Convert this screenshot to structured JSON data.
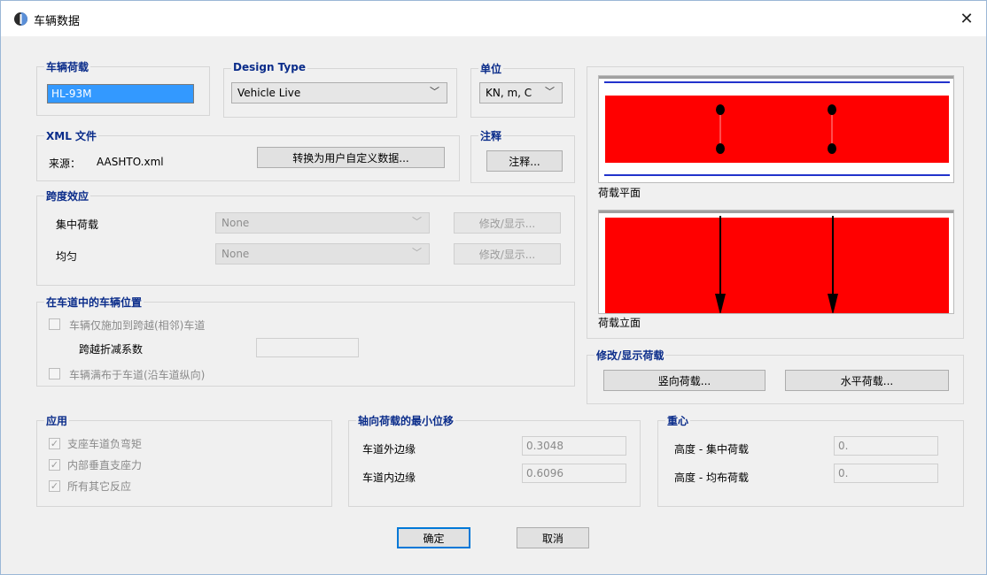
{
  "window": {
    "title": "车辆数据",
    "close_glyph": "✕"
  },
  "vehicle_load": {
    "legend": "车辆荷载",
    "name_value": "HL-93M"
  },
  "design_type": {
    "legend": "Design Type",
    "value": "Vehicle Live"
  },
  "units": {
    "legend": "单位",
    "value": "KN, m, C"
  },
  "xml_file": {
    "legend": "XML 文件",
    "source_label": "来源：",
    "source_value": "AASHTO.xml",
    "convert_button": "转换为用户自定义数据..."
  },
  "notes": {
    "legend": "注释",
    "button": "注释..."
  },
  "span_effect": {
    "legend": "跨度效应",
    "concentrated_label": "集中荷载",
    "concentrated_value": "None",
    "uniform_label": "均匀",
    "uniform_value": "None",
    "modify_button": "修改/显示..."
  },
  "lane_position": {
    "legend": "在车道中的车辆位置",
    "straddle_label": "车辆仅施加到跨越(相邻)车道",
    "straddle_factor_label": "跨越折减系数",
    "straddle_factor_value": "",
    "fill_lane_label": "车辆满布于车道(沿车道纵向)"
  },
  "application": {
    "legend": "应用",
    "items": [
      "支座车道负弯矩",
      "内部垂直支座力",
      "所有其它反应"
    ]
  },
  "axle_min_offset": {
    "legend": "轴向荷载的最小位移",
    "outer_label": "车道外边缘",
    "outer_value": "0.3048",
    "inner_label": "车道内边缘",
    "inner_value": "0.6096"
  },
  "center_of_gravity": {
    "legend": "重心",
    "concentrated_label": "高度 - 集中荷载",
    "concentrated_value": "0.",
    "uniform_label": "高度 - 均布荷载",
    "uniform_value": "0."
  },
  "preview": {
    "plan_label": "荷载平面",
    "elevation_label": "荷载立面"
  },
  "modify_loads": {
    "legend": "修改/显示荷载",
    "vertical_button": "竖向荷载...",
    "horizontal_button": "水平荷载..."
  },
  "footer": {
    "ok_button": "确定",
    "cancel_button": "取消"
  },
  "colors": {
    "load_fill": "#ff0000",
    "lane_line": "#2233cc",
    "accent": "#0078d7",
    "legend_text": "#0a2c8a"
  }
}
